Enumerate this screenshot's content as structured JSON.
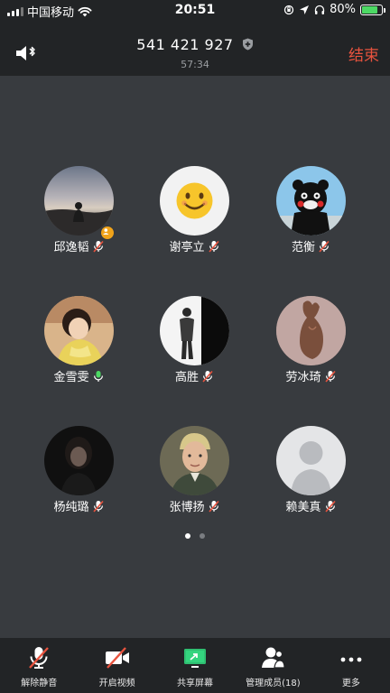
{
  "status_bar": {
    "carrier": "中国移动",
    "time": "20:51",
    "battery": "80%",
    "battery_level": 0.8
  },
  "header": {
    "meeting_id": "541 421 927",
    "duration": "57:34",
    "end_label": "结束"
  },
  "participants": [
    {
      "name": "邱逸韬",
      "mic": "muted",
      "host": true,
      "avatar": "sunset-silhouette"
    },
    {
      "name": "谢亭立",
      "mic": "muted",
      "host": false,
      "avatar": "smiley-face"
    },
    {
      "name": "范衡",
      "mic": "muted",
      "host": false,
      "avatar": "black-bear-mascot"
    },
    {
      "name": "金雪雯",
      "mic": "active",
      "host": false,
      "avatar": "person-photo"
    },
    {
      "name": "高胜",
      "mic": "muted",
      "host": false,
      "avatar": "standing-figure"
    },
    {
      "name": "劳冰琦",
      "mic": "muted",
      "host": false,
      "avatar": "sculpture-photo"
    },
    {
      "name": "杨纯璐",
      "mic": "muted",
      "host": false,
      "avatar": "dark-portrait"
    },
    {
      "name": "张博扬",
      "mic": "muted",
      "host": false,
      "avatar": "boy-portrait"
    },
    {
      "name": "赖美真",
      "mic": "muted",
      "host": false,
      "avatar": "default-avatar"
    }
  ],
  "pagination": {
    "pages": 2,
    "current": 1
  },
  "toolbar": {
    "unmute_label": "解除静音",
    "video_label": "开启视频",
    "share_label": "共享屏幕",
    "manage_label": "管理成员(18)",
    "more_label": "更多"
  },
  "colors": {
    "background": "#383b3f",
    "bar": "#222426",
    "end_red": "#e8533e",
    "muted_red": "#e8533e",
    "mic_active_green": "#4cd964",
    "share_green": "#2fbf71",
    "host_badge": "#f0a31a"
  }
}
